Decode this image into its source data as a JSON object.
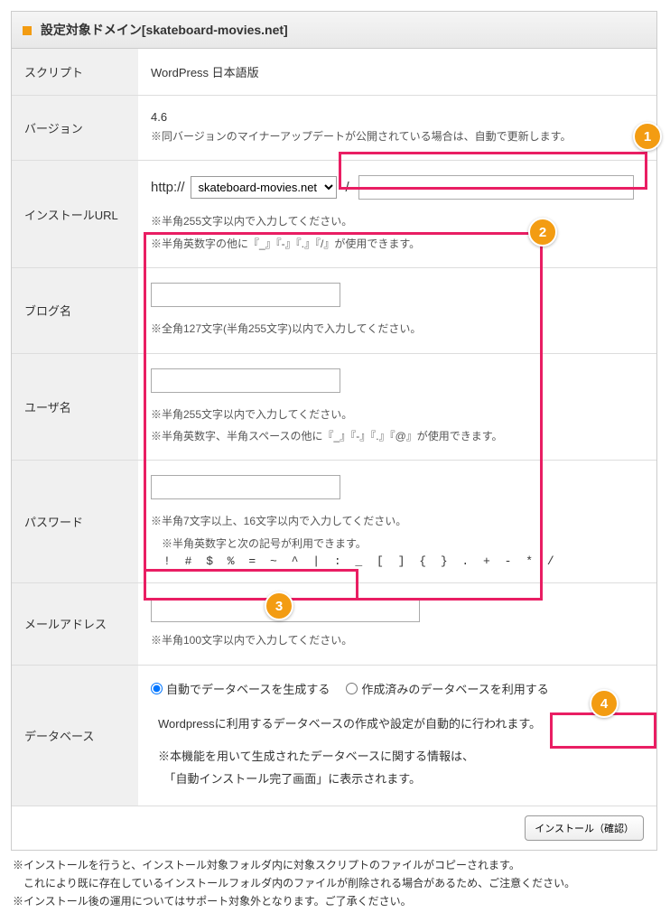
{
  "header": {
    "title": "設定対象ドメイン[skateboard-movies.net]"
  },
  "rows": {
    "script": {
      "label": "スクリプト",
      "value": "WordPress 日本語版"
    },
    "version": {
      "label": "バージョン",
      "value": "4.6",
      "note": "※同バージョンのマイナーアップデートが公開されている場合は、自動で更新します。"
    },
    "install_url": {
      "label": "インストールURL",
      "prefix": "http://",
      "domain_option": "skateboard-movies.net",
      "slash": "/",
      "path_value": "",
      "note1": "※半角255文字以内で入力してください。",
      "note2": "※半角英数字の他に『_』『-』『.』『/』が使用できます。"
    },
    "blog_name": {
      "label": "ブログ名",
      "value": "",
      "note": "※全角127文字(半角255文字)以内で入力してください。"
    },
    "user_name": {
      "label": "ユーザ名",
      "value": "",
      "note1": "※半角255文字以内で入力してください。",
      "note2": "※半角英数字、半角スペースの他に『_』『-』『.』『@』が使用できます。"
    },
    "password": {
      "label": "パスワード",
      "value": "",
      "note1": "※半角7文字以上、16文字以内で入力してください。",
      "note2": "　※半角英数字と次の記号が利用できます。",
      "symbols": "! # $ % = ~ ^ | : _ [ ] { } . + - * /"
    },
    "mail": {
      "label": "メールアドレス",
      "value": "",
      "note": "※半角100文字以内で入力してください。"
    },
    "database": {
      "label": "データベース",
      "radio_auto": "自動でデータベースを生成する",
      "radio_existing": "作成済みのデータベースを利用する",
      "text1": "Wordpressに利用するデータベースの作成や設定が自動的に行われます。",
      "text2": "※本機能を用いて生成されたデータベースに関する情報は、",
      "text3": "　「自動インストール完了画面」に表示されます。"
    }
  },
  "buttons": {
    "install": "インストール（確認）"
  },
  "footer": {
    "line1": "※インストールを行うと、インストール対象フォルダ内に対象スクリプトのファイルがコピーされます。",
    "line2": "　これにより既に存在しているインストールフォルダ内のファイルが削除される場合があるため、ご注意ください。",
    "line3": "※インストール後の運用についてはサポート対象外となります。ご了承ください。"
  },
  "badges": {
    "b1": "1",
    "b2": "2",
    "b3": "3",
    "b4": "4"
  }
}
